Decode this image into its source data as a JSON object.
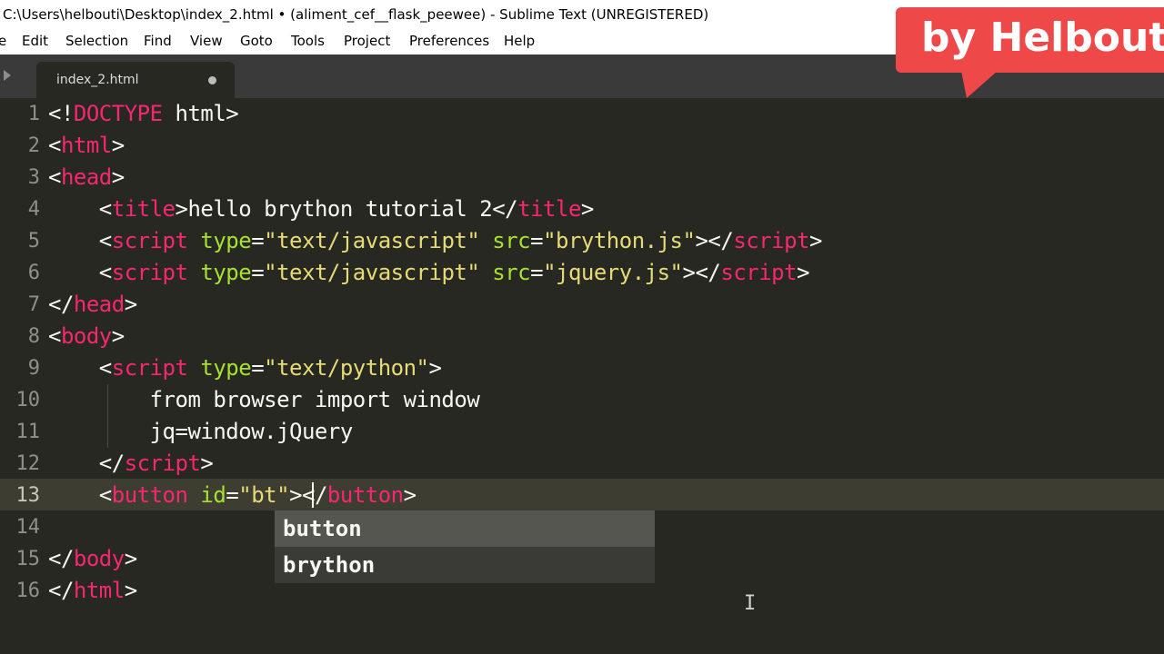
{
  "window": {
    "title": "C:\\Users\\helbouti\\Desktop\\index_2.html • (aliment_cef__flask_peewee) - Sublime Text (UNREGISTERED)"
  },
  "menu": {
    "items": [
      "e",
      "Edit",
      "Selection",
      "Find",
      "View",
      "Goto",
      "Tools",
      "Project",
      "Preferences",
      "Help"
    ]
  },
  "tab": {
    "label": "index_2.html"
  },
  "badge": {
    "text": "by Helbouti"
  },
  "editor": {
    "line_numbers": [
      "1",
      "2",
      "3",
      "4",
      "5",
      "6",
      "7",
      "8",
      "9",
      "10",
      "11",
      "12",
      "13",
      "14",
      "15",
      "16"
    ],
    "current_line": "13",
    "lines": [
      [
        [
          "p",
          "<"
        ],
        [
          "p",
          "!"
        ],
        [
          "t",
          "DOCTYPE"
        ],
        [
          "p",
          " html>"
        ]
      ],
      [
        [
          "p",
          "<"
        ],
        [
          "t",
          "html"
        ],
        [
          "p",
          ">"
        ]
      ],
      [
        [
          "p",
          "<"
        ],
        [
          "t",
          "head"
        ],
        [
          "p",
          ">"
        ]
      ],
      [
        [
          "p",
          "    <"
        ],
        [
          "t",
          "title"
        ],
        [
          "p",
          ">hello brython tutorial 2</"
        ],
        [
          "t",
          "title"
        ],
        [
          "p",
          ">"
        ]
      ],
      [
        [
          "p",
          "    <"
        ],
        [
          "t",
          "script"
        ],
        [
          "p",
          " "
        ],
        [
          "a",
          "type"
        ],
        [
          "p",
          "="
        ],
        [
          "s",
          "\"text/javascript\""
        ],
        [
          "p",
          " "
        ],
        [
          "a",
          "src"
        ],
        [
          "p",
          "="
        ],
        [
          "s",
          "\"brython.js\""
        ],
        [
          "p",
          "></"
        ],
        [
          "t",
          "script"
        ],
        [
          "p",
          ">"
        ]
      ],
      [
        [
          "p",
          "    <"
        ],
        [
          "t",
          "script"
        ],
        [
          "p",
          " "
        ],
        [
          "a",
          "type"
        ],
        [
          "p",
          "="
        ],
        [
          "s",
          "\"text/javascript\""
        ],
        [
          "p",
          " "
        ],
        [
          "a",
          "src"
        ],
        [
          "p",
          "="
        ],
        [
          "s",
          "\"jquery.js\""
        ],
        [
          "p",
          "></"
        ],
        [
          "t",
          "script"
        ],
        [
          "p",
          ">"
        ]
      ],
      [
        [
          "p",
          "</"
        ],
        [
          "t",
          "head"
        ],
        [
          "p",
          ">"
        ]
      ],
      [
        [
          "p",
          "<"
        ],
        [
          "t",
          "body"
        ],
        [
          "p",
          ">"
        ]
      ],
      [
        [
          "p",
          "    <"
        ],
        [
          "t",
          "script"
        ],
        [
          "p",
          " "
        ],
        [
          "a",
          "type"
        ],
        [
          "p",
          "="
        ],
        [
          "s",
          "\"text/python\""
        ],
        [
          "p",
          ">"
        ]
      ],
      [
        [
          "p",
          "        from browser import window"
        ]
      ],
      [
        [
          "p",
          "        jq=window.jQuery"
        ]
      ],
      [
        [
          "p",
          "    </"
        ],
        [
          "t",
          "script"
        ],
        [
          "p",
          ">"
        ]
      ],
      [
        [
          "p",
          "    <"
        ],
        [
          "t",
          "button"
        ],
        [
          "p",
          " "
        ],
        [
          "a",
          "id"
        ],
        [
          "p",
          "="
        ],
        [
          "s",
          "\"bt\""
        ],
        [
          "p",
          "></"
        ],
        [
          "t",
          "button"
        ],
        [
          "p",
          ">"
        ]
      ],
      [
        [
          "p",
          ""
        ]
      ],
      [
        [
          "p",
          "</"
        ],
        [
          "t",
          "body"
        ],
        [
          "p",
          ">"
        ]
      ],
      [
        [
          "p",
          "</"
        ],
        [
          "t",
          "html"
        ],
        [
          "p",
          ">"
        ]
      ]
    ]
  },
  "autocomplete": {
    "items": [
      "button",
      "brython"
    ],
    "selected_index": 0
  },
  "colors": {
    "background": "#272822",
    "tag": "#f92672",
    "attribute": "#a6e22e",
    "string": "#e6db74",
    "text": "#f8f8f2",
    "badge": "#ef4848"
  }
}
